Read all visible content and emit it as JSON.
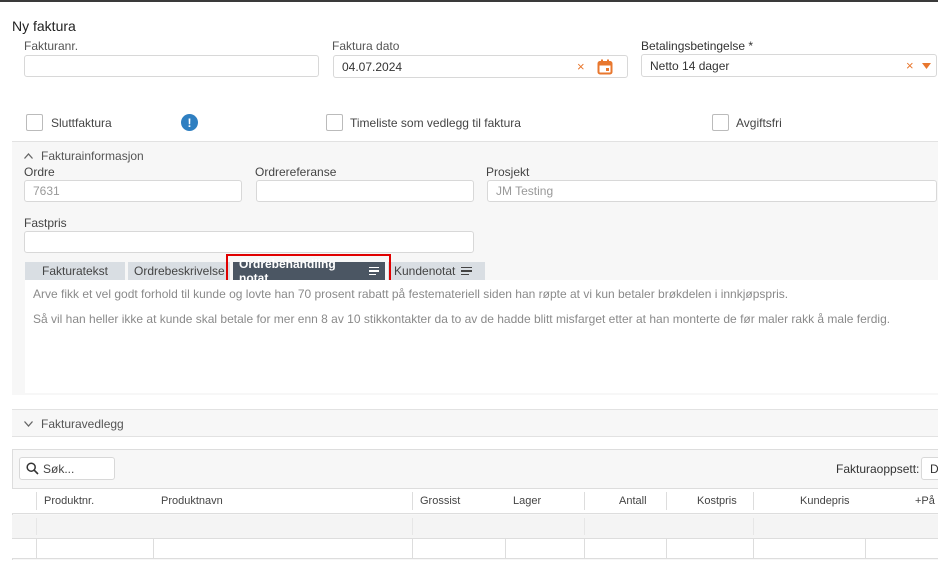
{
  "page": {
    "title": "Ny faktura"
  },
  "header_fields": {
    "invoice_no": {
      "label": "Fakturanr.",
      "value": ""
    },
    "invoice_date": {
      "label": "Faktura dato",
      "value": "04.07.2024"
    },
    "payment_terms": {
      "label": "Betalingsbetingelse *",
      "value": "Netto 14 dager"
    }
  },
  "checkboxes": {
    "final_invoice": {
      "label": "Sluttfaktura",
      "checked": false
    },
    "info_badge": "!",
    "timesheet": {
      "label": "Timeliste som vedlegg til faktura",
      "checked": false
    },
    "fee_free": {
      "label": "Avgiftsfri",
      "checked": false
    }
  },
  "invoice_info": {
    "section_title": "Fakturainformasjon",
    "order": {
      "label": "Ordre",
      "value": "7631"
    },
    "order_ref": {
      "label": "Ordrereferanse",
      "value": ""
    },
    "project": {
      "label": "Prosjekt",
      "value": "JM Testing"
    },
    "fixed_price": {
      "label": "Fastpris",
      "value": ""
    },
    "tabs": [
      "Fakturatekst",
      "Ordrebeskrivelse",
      "Ordrebehandling notat",
      "Kundenotat"
    ],
    "active_tab": "Ordrebehandling notat",
    "note_lines": [
      "Arve fikk et vel godt forhold til kunde og lovte han 70 prosent rabatt på festemateriell siden han røpte at vi kun betaler brøkdelen i innkjøpspris.",
      "Så vil han heller ikke at kunde skal betale for mer enn 8 av 10 stikkontakter da to av de hadde blitt misfarget etter at han monterte de før maler rakk å male ferdig."
    ]
  },
  "attachments": {
    "section_title": "Fakturavedlegg"
  },
  "products": {
    "search_placeholder": "Søk...",
    "layout_label": "Fakturaoppsett:",
    "layout_value": "D",
    "columns": [
      "Produktnr.",
      "Produktnavn",
      "Grossist",
      "Lager",
      "Antall",
      "Kostpris",
      "Kundepris",
      "+På"
    ]
  },
  "colors": {
    "accent": "#e8772e",
    "info": "#2f7fc1",
    "active_tab": "#4b5663",
    "highlight": "#e00000"
  }
}
